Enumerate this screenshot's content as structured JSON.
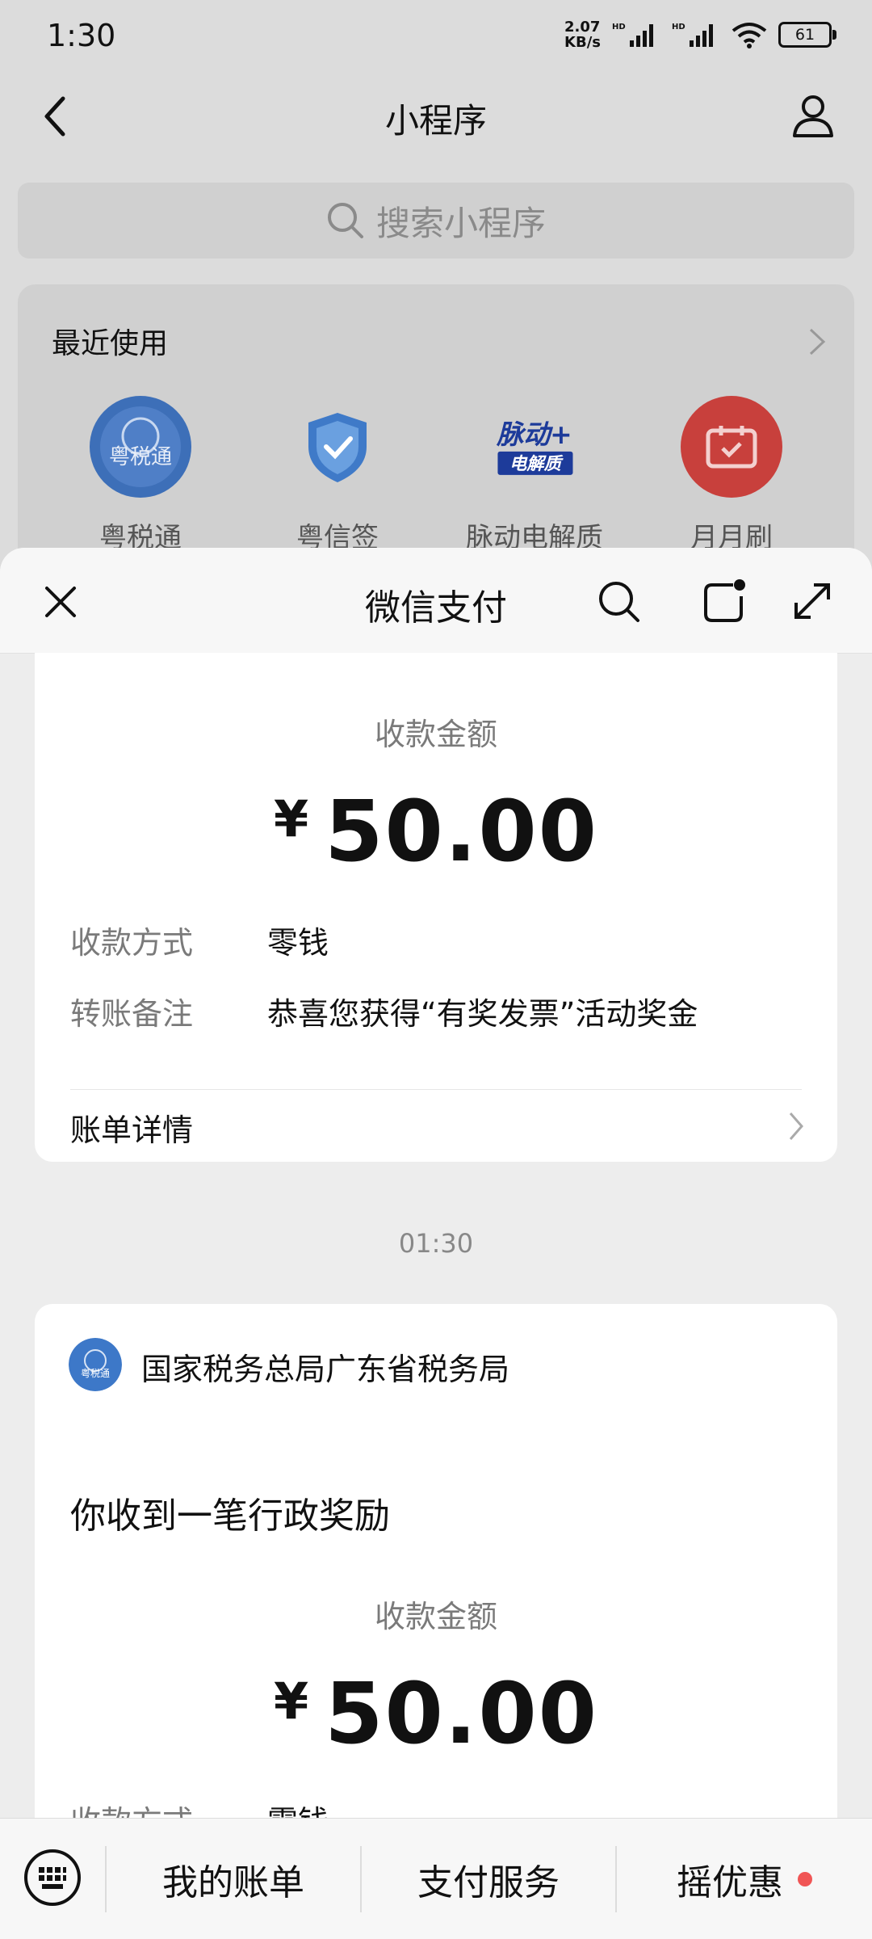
{
  "status_bar": {
    "time": "1:30",
    "net_speed_value": "2.07",
    "net_speed_unit": "KB/s",
    "hd1": "HD",
    "hd2": "HD",
    "battery": "61"
  },
  "mini_program_page": {
    "title": "小程序",
    "search_placeholder": "搜索小程序",
    "recent_title": "最近使用",
    "recent_apps": [
      {
        "name": "粤税通",
        "logo_text": "粤税通"
      },
      {
        "name": "粤信签"
      },
      {
        "name": "脉动电解质",
        "logo_line1": "脉动+",
        "logo_line2": "电解质"
      },
      {
        "name": "月月刷"
      }
    ]
  },
  "sheet": {
    "title": "微信支付",
    "card1": {
      "amount_label": "收款金额",
      "currency": "¥",
      "amount": "50.00",
      "method_label": "收款方式",
      "method_value": "零钱",
      "remark_label": "转账备注",
      "remark_value": "恭喜您获得“有奖发票”活动奖金",
      "bill_detail": "账单详情"
    },
    "timestamp": "01:30",
    "card2": {
      "sender": "国家税务总局广东省税务局",
      "logo_text": "粤税通",
      "notice": "你收到一笔行政奖励",
      "amount_label": "收款金额",
      "currency": "¥",
      "amount": "50.00",
      "method_label": "收款方式",
      "method_value": "零钱"
    }
  },
  "bottom_bar": {
    "items": [
      "我的账单",
      "支付服务",
      "摇优惠"
    ]
  },
  "colors": {
    "accent_red": "#f05555",
    "tax_blue": "#3d78c8",
    "red_app": "#d9443f"
  }
}
